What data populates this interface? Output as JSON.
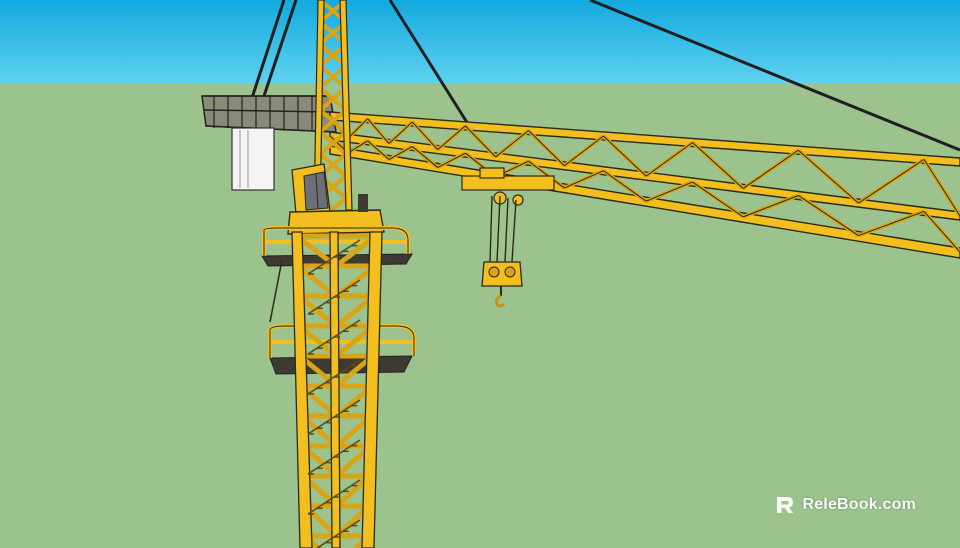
{
  "scene": {
    "subject": "tower-crane",
    "colors": {
      "sky": "#31c3ea",
      "ground": "#9cc28d",
      "crane_yellow": "#f2bf1e",
      "crane_shadow": "#c79412",
      "outline": "#2a2a1a",
      "platform_dark": "#3c3a32",
      "cable": "#1f1f1f"
    }
  },
  "watermark": {
    "brand": "ReleBook.com",
    "logo_icon": "relebook-logo-icon"
  }
}
